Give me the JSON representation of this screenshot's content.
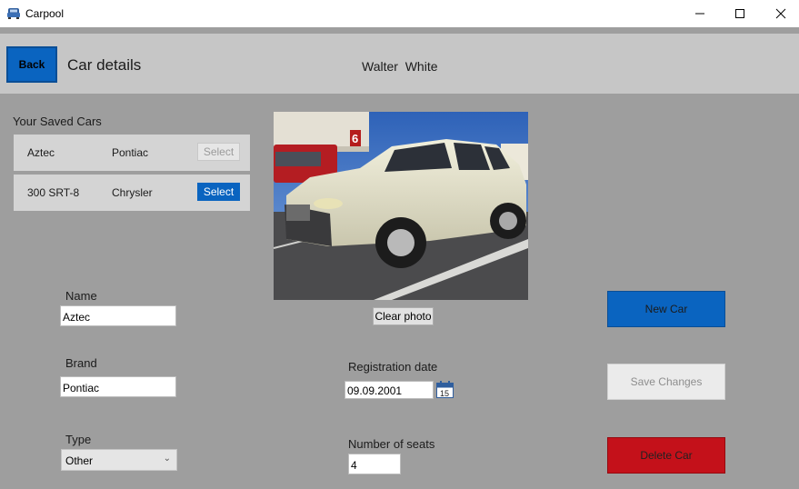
{
  "window": {
    "title": "Carpool",
    "minimize_icon": "minimize-icon",
    "maximize_icon": "maximize-icon",
    "close_icon": "close-icon",
    "app_icon": "car-icon"
  },
  "header": {
    "back_label": "Back",
    "page_title": "Car details",
    "user_name": "Walter  White"
  },
  "saved_cars": {
    "label": "Your Saved Cars",
    "items": [
      {
        "name": "Aztec",
        "brand": "Pontiac",
        "button": "Select",
        "state": "disabled"
      },
      {
        "name": "300 SRT-8",
        "brand": "Chrysler",
        "button": "Select",
        "state": "active"
      }
    ]
  },
  "photo": {
    "clear_label": "Clear photo",
    "sign_text": "6"
  },
  "form": {
    "name_label": "Name",
    "name_value": "Aztec",
    "brand_label": "Brand",
    "brand_value": "Pontiac",
    "type_label": "Type",
    "type_value": "Other",
    "registration_label": "Registration date",
    "registration_value": "09.09.2001",
    "calendar_day": "15",
    "seats_label": "Number of seats",
    "seats_value": "4"
  },
  "actions": {
    "new_car": "New Car",
    "save_changes": "Save Changes",
    "delete_car": "Delete Car"
  },
  "colors": {
    "accent_blue": "#0a64c0",
    "danger_red": "#c4111a",
    "background": "#9e9e9e",
    "header": "#c6c6c6"
  }
}
